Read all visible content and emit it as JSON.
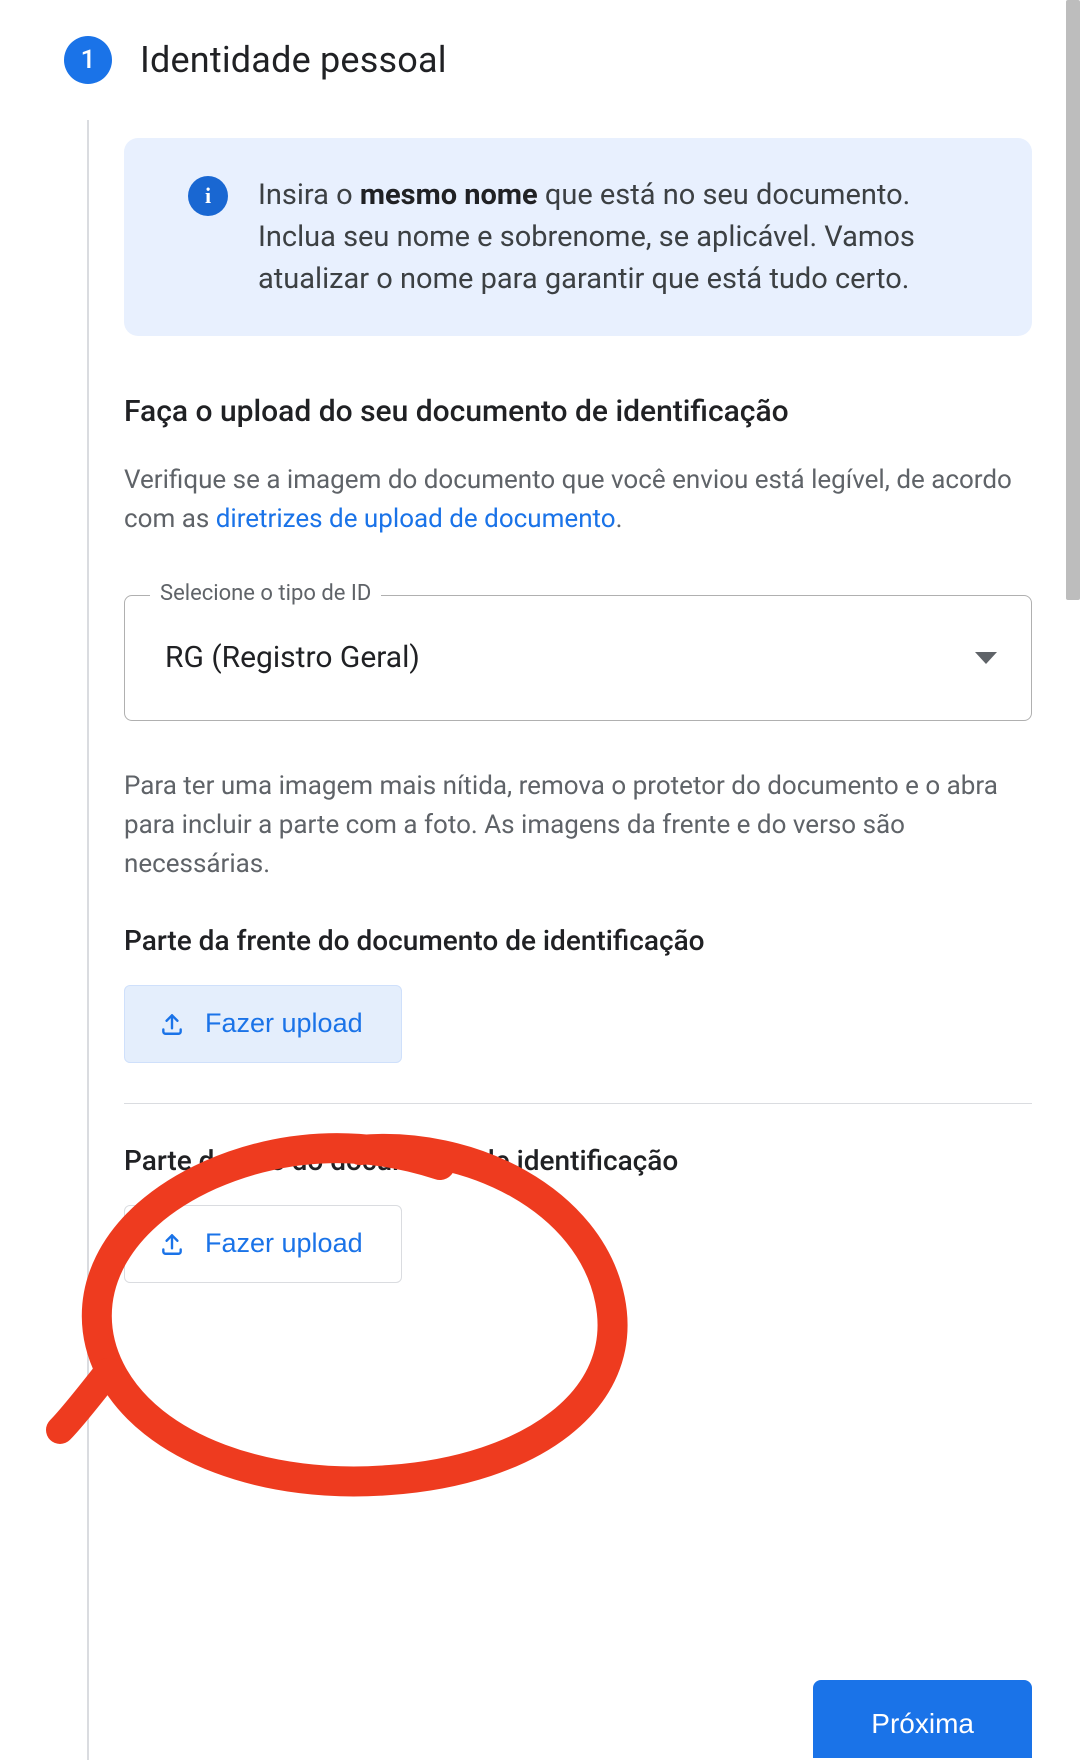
{
  "step": {
    "number": "1",
    "title": "Identidade pessoal"
  },
  "info": {
    "text_before": "Insira o ",
    "bold": "mesmo nome",
    "text_after": " que está no seu documento. Inclua seu nome e sobrenome, se aplicável. Vamos atualizar o nome para garantir que está tudo certo."
  },
  "upload_section": {
    "title": "Faça o upload do seu documento de identificação",
    "verify_before": "Verifique se a imagem do documento que você enviou está legível, de acordo com as ",
    "link_text": "diretrizes de upload de documento",
    "verify_after": "."
  },
  "select": {
    "label": "Selecione o tipo de ID",
    "value": "RG (Registro Geral)"
  },
  "hint_text": "Para ter uma imagem mais nítida, remova o protetor do documento e o abra para incluir a parte com a foto. As imagens da frente e do verso são necessárias.",
  "front": {
    "label": "Parte da frente do documento de identificação",
    "button": "Fazer upload"
  },
  "back": {
    "label": "Parte de trás do documento de identificação",
    "button": "Fazer upload"
  },
  "next_button": "Próxima",
  "colors": {
    "primary": "#1a73e8",
    "info_bg": "#e8f0fe",
    "text_primary": "#202124",
    "text_secondary": "#5f6368",
    "annotation": "#ee3b1f"
  }
}
